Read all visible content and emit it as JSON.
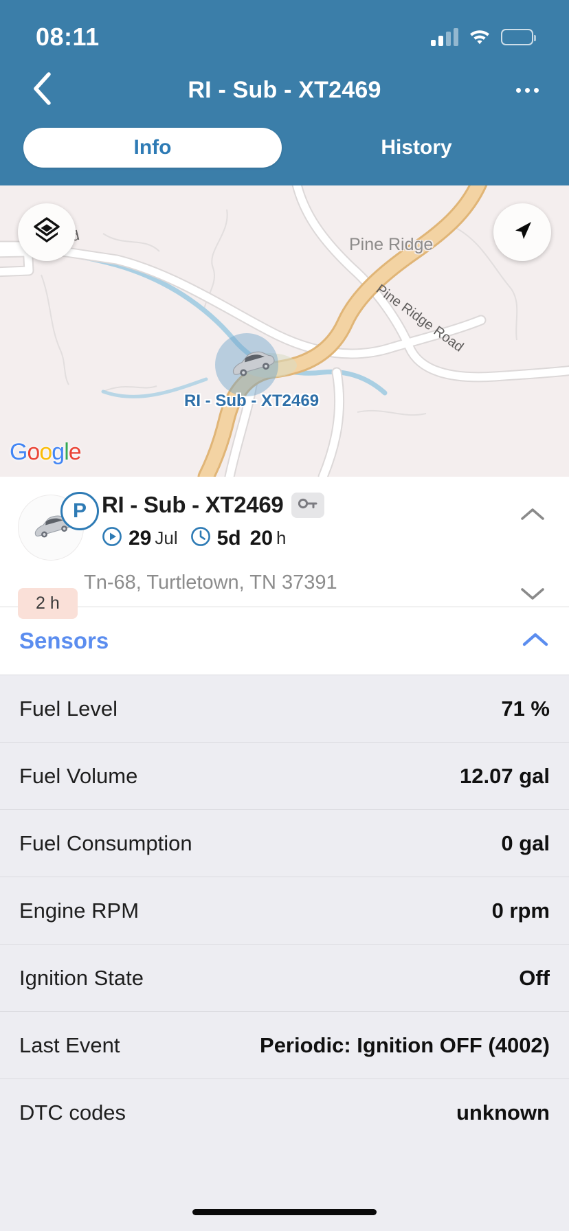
{
  "status_bar": {
    "time": "08:11",
    "cellular_icon": "cellular-bars-icon",
    "wifi_icon": "wifi-icon",
    "battery_icon": "battery-full-icon"
  },
  "nav": {
    "back_icon": "chevron-left-icon",
    "title": "RI - Sub - XT2469",
    "more_icon": "ellipsis-icon"
  },
  "tabs": [
    {
      "label": "Info",
      "active": true
    },
    {
      "label": "History",
      "active": false
    }
  ],
  "map": {
    "layers_icon": "layers-icon",
    "locate_icon": "navigate-arrow-icon",
    "vehicle_icon": "car-icon",
    "marker_label": "RI - Sub - XT2469",
    "place_label": "Pine Ridge",
    "road_label_1": "Pine Ridge Road",
    "road_label_2": "oad",
    "attribution": {
      "g1": "G",
      "o1": "o",
      "o2": "o",
      "g2": "g",
      "l": "l",
      "e": "e"
    },
    "colors": {
      "land": "#F4EEEE",
      "highway": "#F0CE9A",
      "road": "#FFFFFF",
      "water": "#A9CFE3",
      "marker_halo": "#6EA3C9"
    }
  },
  "vehicle_card": {
    "parking_badge": "P",
    "name": "RI - Sub - XT2469",
    "key_icon": "key-icon",
    "date_icon": "play-circle-icon",
    "date_value": "29",
    "date_unit": "Jul",
    "duration_icon": "clock-icon",
    "duration_days": "5d",
    "duration_hours": "20",
    "duration_hours_unit": "h",
    "hours_badge": "2 h",
    "address": "Tn-68, Turtletown, TN 37391",
    "collapse_icon": "chevron-up-icon",
    "expand_icon": "chevron-down-icon"
  },
  "sensors": {
    "title": "Sensors",
    "toggle_icon": "chevron-up-icon",
    "accent_color": "#5B8DEF",
    "rows": [
      {
        "label": "Fuel Level",
        "value": "71 %"
      },
      {
        "label": "Fuel Volume",
        "value": "12.07 gal"
      },
      {
        "label": "Fuel Consumption",
        "value": "0 gal"
      },
      {
        "label": "Engine RPM",
        "value": "0 rpm"
      },
      {
        "label": "Ignition State",
        "value": "Off"
      },
      {
        "label": "Last Event",
        "value": "Periodic: Ignition OFF (4002)"
      },
      {
        "label": "DTC codes",
        "value": "unknown"
      }
    ]
  },
  "theme": {
    "header_blue": "#3B7EA9",
    "tab_text_blue": "#2E7BB5",
    "sensor_bg": "#EDEDF2",
    "badge_pink": "#FAE0D8"
  }
}
